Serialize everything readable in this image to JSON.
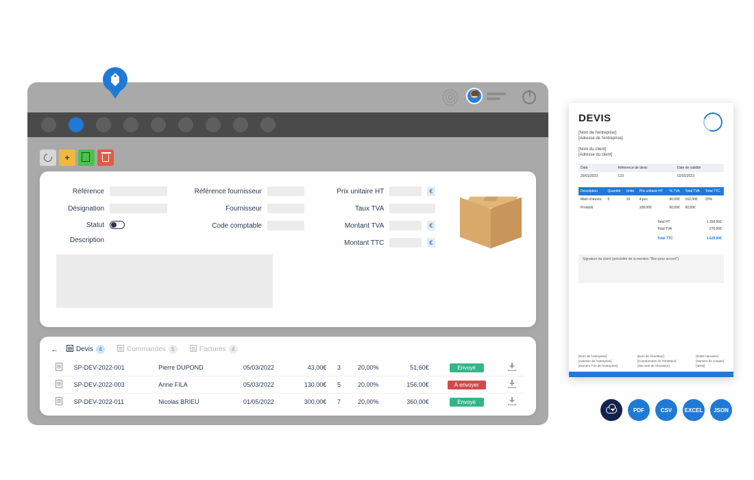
{
  "toolbar": {
    "refresh": "refresh",
    "add": "+",
    "copy": "copy",
    "delete": "delete"
  },
  "form": {
    "reference_label": "Référence",
    "designation_label": "Désignation",
    "statut_label": "Statut",
    "description_label": "Description",
    "ref_fournisseur_label": "Référence fournisseur",
    "fournisseur_label": "Fournisseur",
    "code_comptable_label": "Code comptable",
    "prix_unitaire_label": "Prix unitaire HT",
    "taux_tva_label": "Taux TVA",
    "montant_tva_label": "Montant TVA",
    "montant_ttc_label": "Montant TTC",
    "currency": "€"
  },
  "tabs": {
    "devis": {
      "label": "Devis",
      "count": "4"
    },
    "commandes": {
      "label": "Commandes",
      "count": "5"
    },
    "factures": {
      "label": "Factures",
      "count": "4"
    }
  },
  "status": {
    "sent": "Envoyé",
    "to_send": "À envoyer"
  },
  "rows": [
    {
      "ref": "SP-DEV-2022-001",
      "client": "Pierre DUPOND",
      "date": "05/03/2022",
      "amount": "43,00€",
      "qty": "3",
      "rate": "20,00%",
      "total": "51,60€",
      "status": "sent"
    },
    {
      "ref": "SP-DEV-2022-003",
      "client": "Anne FILA",
      "date": "05/03/2022",
      "amount": "130,00€",
      "qty": "5",
      "rate": "20,00%",
      "total": "156,00€",
      "status": "to_send"
    },
    {
      "ref": "SP-DEV-2022-011",
      "client": "Nicolas BRIEU",
      "date": "01/05/2022",
      "amount": "300,00€",
      "qty": "7",
      "rate": "20,00%",
      "total": "360,00€",
      "status": "sent"
    }
  ],
  "doc": {
    "title": "DEVIS",
    "company_name": "[Nom de l'entreprise]",
    "company_addr": "[Adresse de l'entreprise]",
    "client_name": "[Nom du client]",
    "client_addr": "[Adresse du client]",
    "meta": {
      "date_h": "Date",
      "ref_h": "Référence de devis",
      "valid_h": "Date  de validité",
      "date": "29/01/2023",
      "ref": "123",
      "valid": "02/02/2023"
    },
    "cols": {
      "desc": "Description",
      "qty": "Quantité",
      "unit": "Unité",
      "pu": "Prix unitaire HT",
      "tva": "% TVA",
      "tot_tva": "Total TVA",
      "tot": "Total TTC"
    },
    "line1": {
      "desc": "Main d'œuvre",
      "qty": "5",
      "unit": "10",
      "pu": "4 pcs",
      "tva": "90,00€",
      "tot_tva": "162,00€",
      "tot": "20%"
    },
    "line2": {
      "desc": "Produits",
      "qty": "",
      "unit": "",
      "pu": "108,00€",
      "tva": "50,00€",
      "tot_tva": "60,00€",
      "tot": ""
    },
    "totals": {
      "ht_l": "Total HT",
      "ht": "1 350,00€",
      "tva_l": "Total TVA",
      "tva": "270,00€",
      "ttc_l": "Total TTC",
      "ttc": "1 620,00€"
    },
    "sig": "Signature du client (précédée de la mention \"Bon pour accord\")",
    "f1a": "[Nom de l'entreprise]",
    "f1b": "[Adresse de l'entreprise]",
    "f1c": "[Numéro TVA de l'entreprise]",
    "f2a": "[Nom de l'émetteur]",
    "f2b": "[Coordonnées de l'émetteur]",
    "f2c": "[Site web de l'émetteur]",
    "f3a": "[Entité bancaire]",
    "f3b": "[Numéro de compte]",
    "f3c": "[IBAN]"
  },
  "exports": {
    "pdf": "PDF",
    "csv": "CSV",
    "excel": "EXCEL",
    "json": "JSON"
  }
}
